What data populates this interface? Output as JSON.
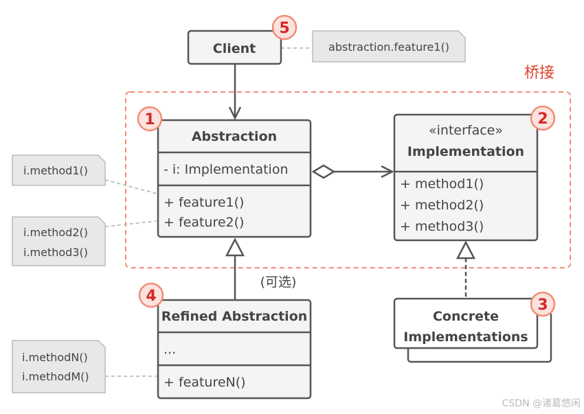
{
  "title": "桥接",
  "client": {
    "name": "Client",
    "badge": "5",
    "note": "abstraction.feature1()"
  },
  "abstraction": {
    "name": "Abstraction",
    "badge": "1",
    "field": "- i: Implementation",
    "methods": [
      "+ feature1()",
      "+ feature2()"
    ]
  },
  "implementation": {
    "stereotype": "«interface»",
    "name": "Implementation",
    "badge": "2",
    "methods": [
      "+ method1()",
      "+ method2()",
      "+ method3()"
    ]
  },
  "concrete": {
    "name_line1": "Concrete",
    "name_line2": "Implementations",
    "badge": "3"
  },
  "refined": {
    "name": "Refined Abstraction",
    "badge": "4",
    "field": "...",
    "methods": [
      "+ featureN()"
    ],
    "optional_label": "(可选)"
  },
  "notes": {
    "feature1": [
      "i.method1()"
    ],
    "feature2": [
      "i.method2()",
      "i.method3()"
    ],
    "featureN": [
      "i.methodN()",
      "i.methodM()"
    ]
  },
  "watermark": "CSDN @诸葛悠闲",
  "colors": {
    "accent": "#f28b74",
    "badge_text": "#d12a2a",
    "stroke": "#555555"
  }
}
